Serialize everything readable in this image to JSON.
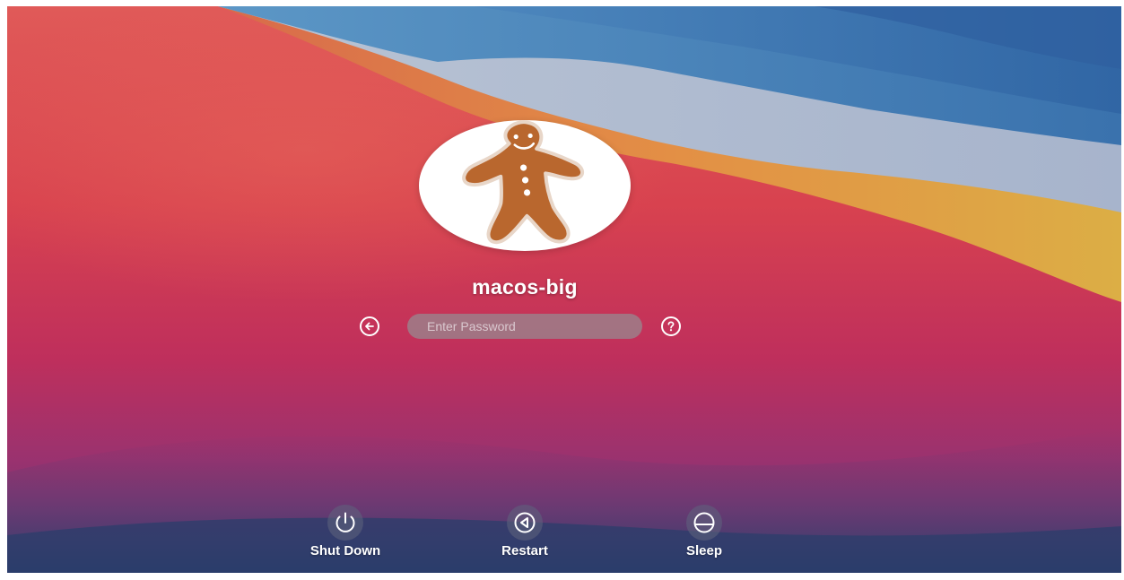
{
  "user": {
    "name": "macos-big",
    "avatar_icon": "gingerbread-man-icon"
  },
  "login": {
    "password_placeholder": "Enter Password",
    "back_icon": "arrow-left-circle-icon",
    "help_icon": "question-circle-icon"
  },
  "power_actions": [
    {
      "label": "Shut Down",
      "icon": "power-icon"
    },
    {
      "label": "Restart",
      "icon": "restart-icon"
    },
    {
      "label": "Sleep",
      "icon": "sleep-icon"
    }
  ],
  "colors": {
    "wallpaper_red": "#d8414f",
    "wallpaper_blue": "#3f78b2",
    "wallpaper_orange": "#e0a043",
    "wallpaper_magenta": "#a83272",
    "wallpaper_navy": "#2c3f6d",
    "text": "#ffffff"
  }
}
